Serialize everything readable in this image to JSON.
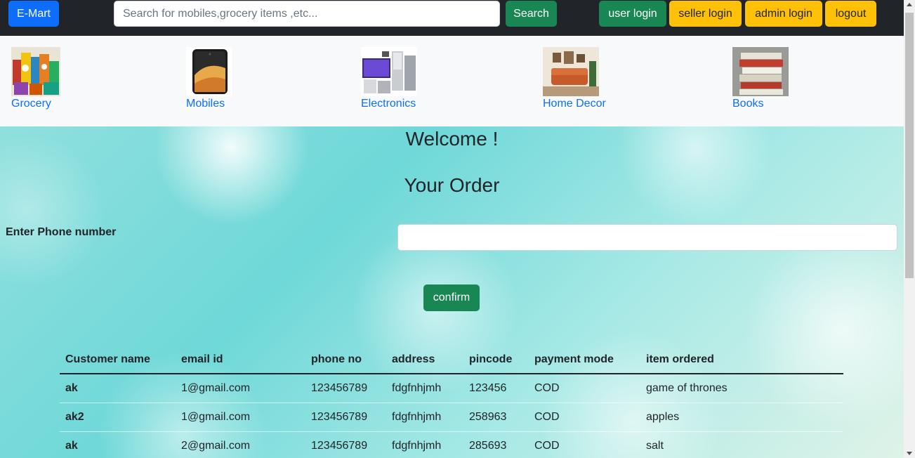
{
  "navbar": {
    "brand": "E-Mart",
    "search_placeholder": "Search for mobiles,grocery items ,etc...",
    "search_label": "Search",
    "user_login": "user login",
    "seller_login": "seller login",
    "admin_login": "admin login",
    "logout": "logout"
  },
  "categories": [
    {
      "label": "Grocery",
      "icon": "grocery-image"
    },
    {
      "label": "Mobiles",
      "icon": "smartphone-image"
    },
    {
      "label": "Electronics",
      "icon": "electronics-image"
    },
    {
      "label": "Home Decor",
      "icon": "living-room-image"
    },
    {
      "label": "Books",
      "icon": "books-stack-image"
    }
  ],
  "main": {
    "welcome": "Welcome !",
    "title": "Your Order",
    "phone_label": "Enter Phone number",
    "phone_value": "",
    "confirm_label": "confirm"
  },
  "orders": {
    "headers": [
      "Customer name",
      "email id",
      "phone no",
      "address",
      "pincode",
      "payment mode",
      "item ordered"
    ],
    "rows": [
      [
        "ak",
        "1@gmail.com",
        "123456789",
        "fdgfnhjmh",
        "123456",
        "COD",
        "game of thrones"
      ],
      [
        "ak2",
        "1@gmail.com",
        "123456789",
        "fdgfnhjmh",
        "258963",
        "COD",
        "apples"
      ],
      [
        "ak",
        "2@gmail.com",
        "123456789",
        "fdgfnhjmh",
        "285693",
        "COD",
        "salt"
      ]
    ]
  },
  "colors": {
    "navbar_bg": "#212529",
    "primary": "#0d6efd",
    "success": "#198754",
    "warning": "#ffc107"
  }
}
